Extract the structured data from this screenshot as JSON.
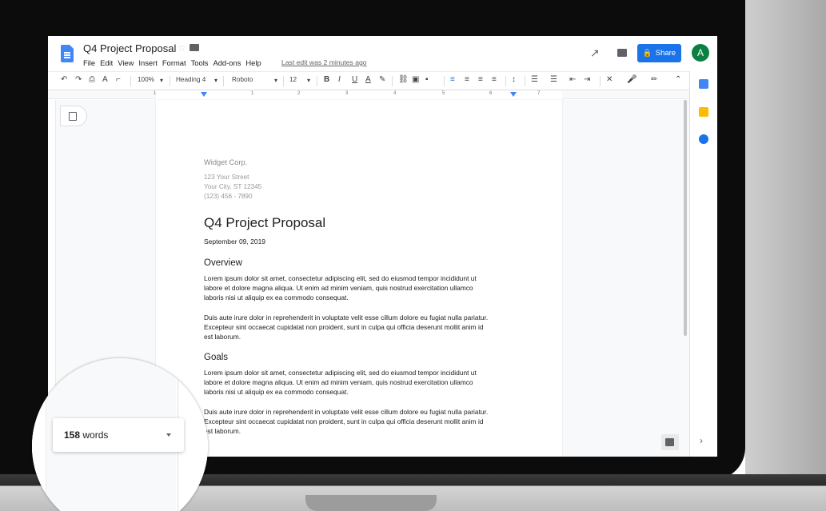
{
  "app": {
    "doc_title": "Q4 Project Proposal",
    "menu": [
      "File",
      "Edit",
      "View",
      "Insert",
      "Format",
      "Tools",
      "Add-ons",
      "Help"
    ],
    "last_edit": "Last edit was 2 minutes ago",
    "share_label": "Share",
    "avatar_letter": "A"
  },
  "toolbar": {
    "zoom": "100%",
    "style": "Heading 4",
    "font": "Roboto",
    "font_size": "12"
  },
  "ruler_numbers": [
    "1",
    "1",
    "2",
    "3",
    "4",
    "5",
    "6",
    "7"
  ],
  "document": {
    "company": "Widget Corp.",
    "address": [
      "123 Your Street",
      "Your City, ST 12345",
      "(123) 456 - 7890"
    ],
    "title": "Q4 Project Proposal",
    "date": "September 09, 2019",
    "sections": [
      {
        "heading": "Overview",
        "paragraphs": [
          [
            "Lorem ipsum dolor sit amet, consectetur adipiscing elit, sed do eiusmod tempor incididunt ut",
            "labore et dolore magna aliqua. Ut enim ad minim veniam, quis nostrud exercitation ullamco",
            "laboris nisi ut aliquip ex ea commodo consequat."
          ],
          [
            "Duis aute irure dolor in reprehenderit in voluptate velit esse cillum dolore eu fugiat nulla pariatur.",
            "Excepteur sint occaecat cupidatat non proident, sunt in culpa qui officia deserunt mollit anim id",
            "est laborum."
          ]
        ]
      },
      {
        "heading": "Goals",
        "paragraphs": [
          [
            "Lorem ipsum dolor sit amet, consectetur adipiscing elit, sed do eiusmod tempor incididunt ut",
            "labore et dolore magna aliqua. Ut enim ad minim veniam, quis nostrud exercitation ullamco",
            "laboris nisi ut aliquip ex ea commodo consequat."
          ],
          [
            "Duis aute irure dolor in reprehenderit in voluptate velit esse cillum dolore eu fugiat nulla pariatur.",
            "Excepteur sint occaecat cupidatat non proident, sunt in culpa qui officia deserunt mollit anim id",
            "est laborum."
          ]
        ]
      }
    ]
  },
  "word_count": {
    "count": "158",
    "unit": "words"
  },
  "side_icons": [
    "calendar-icon",
    "keep-icon",
    "tasks-icon"
  ],
  "colors": {
    "accent": "#1a73e8",
    "avatar": "#0b8043",
    "docs_blue": "#4285f4",
    "keep_yellow": "#fbbc04"
  }
}
